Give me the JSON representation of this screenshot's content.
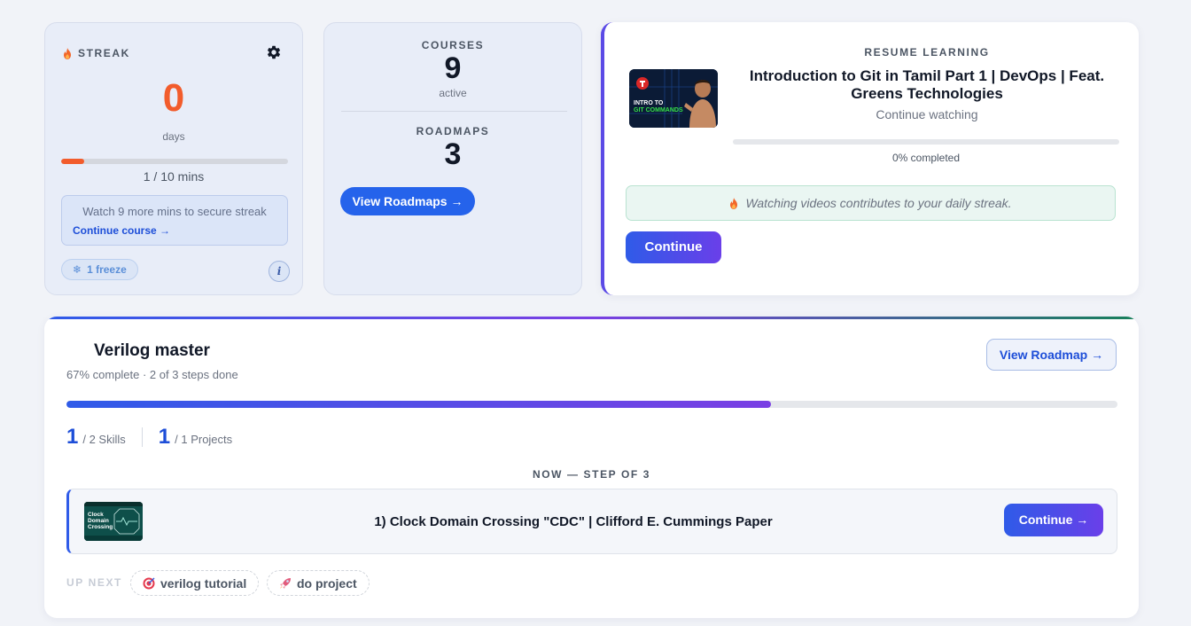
{
  "streak": {
    "label": "STREAK",
    "count": "0",
    "unit": "days",
    "progress_fraction": 0.1,
    "progress_text": "1 / 10 mins",
    "tip_text": "Watch 9 more mins to secure streak",
    "tip_link": "Continue course →",
    "freeze_label": "1 freeze",
    "info_label": "i"
  },
  "stats": {
    "courses_label": "COURSES",
    "courses_value": "9",
    "courses_sub": "active",
    "roadmaps_label": "ROADMAPS",
    "roadmaps_value": "3",
    "view_roadmaps_label": "View Roadmaps →"
  },
  "resume": {
    "label": "RESUME LEARNING",
    "title": "Introduction to Git in Tamil Part 1 | DevOps | Feat. Greens Technologies",
    "subtitle": "Continue watching",
    "progress_fraction": 0,
    "progress_text": "0% completed",
    "note": "Watching videos contributes to your daily streak.",
    "continue_label": "Continue",
    "thumb_text_1": "INTRO TO",
    "thumb_text_2": "GIT COMMANDS"
  },
  "roadmap": {
    "title": "Verilog master",
    "subtitle": "67% complete · 2 of 3 steps done",
    "progress_fraction": 0.67,
    "view_label": "View Roadmap →",
    "skills_value": "1",
    "skills_text": "/ 2 Skills",
    "projects_value": "1",
    "projects_text": "/ 1 Projects",
    "now_label": "NOW — STEP OF 3",
    "step_title": "1) Clock Domain Crossing \"CDC\" | Clifford E. Cummings Paper",
    "step_continue": "Continue →",
    "step_thumb_text": "Clock Domain Crossing",
    "up_next_label": "UP NEXT",
    "up_next": [
      {
        "icon": "target-icon",
        "label": "verilog tutorial"
      },
      {
        "icon": "rocket-icon",
        "label": "do project"
      }
    ]
  },
  "colors": {
    "accent_blue": "#2563eb",
    "streak_orange": "#f25c2c",
    "gradient_start": "#2f5be8",
    "gradient_end": "#6a3fe9"
  }
}
